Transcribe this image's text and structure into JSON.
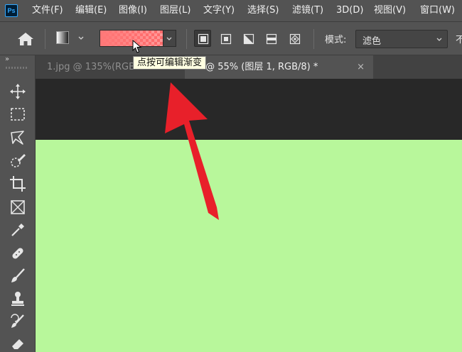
{
  "app": {
    "logo_text": "Ps"
  },
  "menu": [
    "文件(F)",
    "编辑(E)",
    "图像(I)",
    "图层(L)",
    "文字(Y)",
    "选择(S)",
    "滤镜(T)",
    "3D(D)",
    "视图(V)",
    "窗口(W)"
  ],
  "options_bar": {
    "gradient_types": [
      "linear",
      "radial",
      "angle",
      "reflected",
      "diamond"
    ],
    "active_gradient_type": "linear",
    "mode_label": "模式:",
    "mode_value": "滤色",
    "opacity_label_partial": "不",
    "gradient_colors": [
      "#ff7878",
      "#ff9a9a"
    ]
  },
  "tooltip": {
    "text": "点按可编辑渐变"
  },
  "tabs": [
    {
      "label": "1.jpg @ 135%(RGB",
      "active": false
    },
    {
      "label": "-1 @ 55% (图层 1, RGB/8) *",
      "active": true,
      "close": "×"
    }
  ],
  "toolbar": {
    "collapse": "»",
    "tools": [
      "move-tool",
      "marquee-tool",
      "lasso-tool",
      "quick-selection-tool",
      "crop-tool",
      "frame-tool",
      "eyedropper-tool",
      "healing-brush-tool",
      "brush-tool",
      "clone-stamp-tool",
      "history-brush-tool",
      "eraser-tool"
    ]
  },
  "colors": {
    "ui_bg": "#535353",
    "pasteboard": "#282828",
    "canvas_fill": "#b8f79b",
    "annotation_arrow": "#e8202a"
  }
}
